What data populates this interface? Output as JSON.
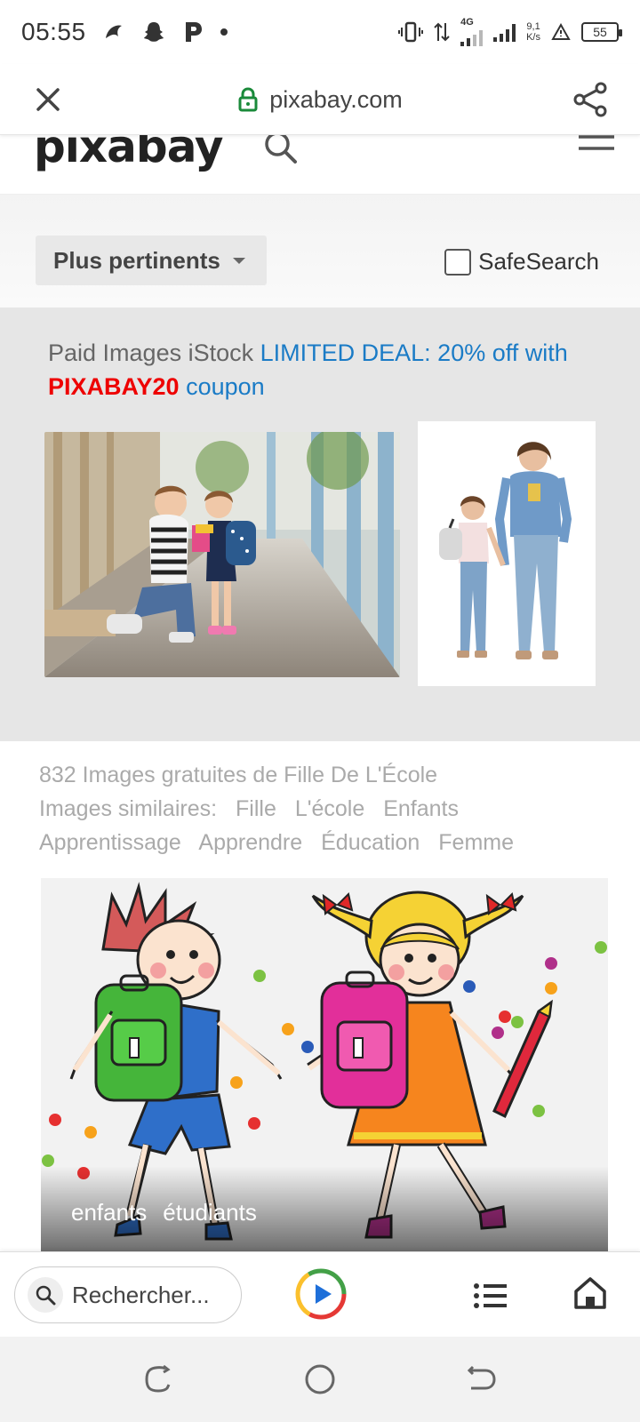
{
  "status": {
    "time": "05:55",
    "network": "4G",
    "speed_value": "9,1",
    "speed_unit": "K/s",
    "battery": "55"
  },
  "tabbar": {
    "url": "pixabay.com"
  },
  "site": {
    "logo_text": "pixabay"
  },
  "filters": {
    "sort_label": "Plus pertinents",
    "safesearch_label": "SafeSearch"
  },
  "sponsored": {
    "prefix": "Paid Images iStock",
    "deal": "LIMITED DEAL: 20% off with",
    "code": "PIXABAY20",
    "suffix": "coupon"
  },
  "results": {
    "summary": "832 Images gratuites de Fille De L'École",
    "similar_label": "Images similaires:",
    "related": [
      "Fille",
      "L'école",
      "Enfants"
    ],
    "related2": [
      "Apprentissage",
      "Apprendre",
      "Éducation",
      "Femme"
    ],
    "tags": [
      "enfants",
      "étudiants"
    ]
  },
  "toolbar": {
    "search_placeholder": "Rechercher..."
  },
  "colors": {
    "deal_blue": "#1a7bc6",
    "code_red": "#e00000",
    "lock_green": "#1a8a3a"
  }
}
